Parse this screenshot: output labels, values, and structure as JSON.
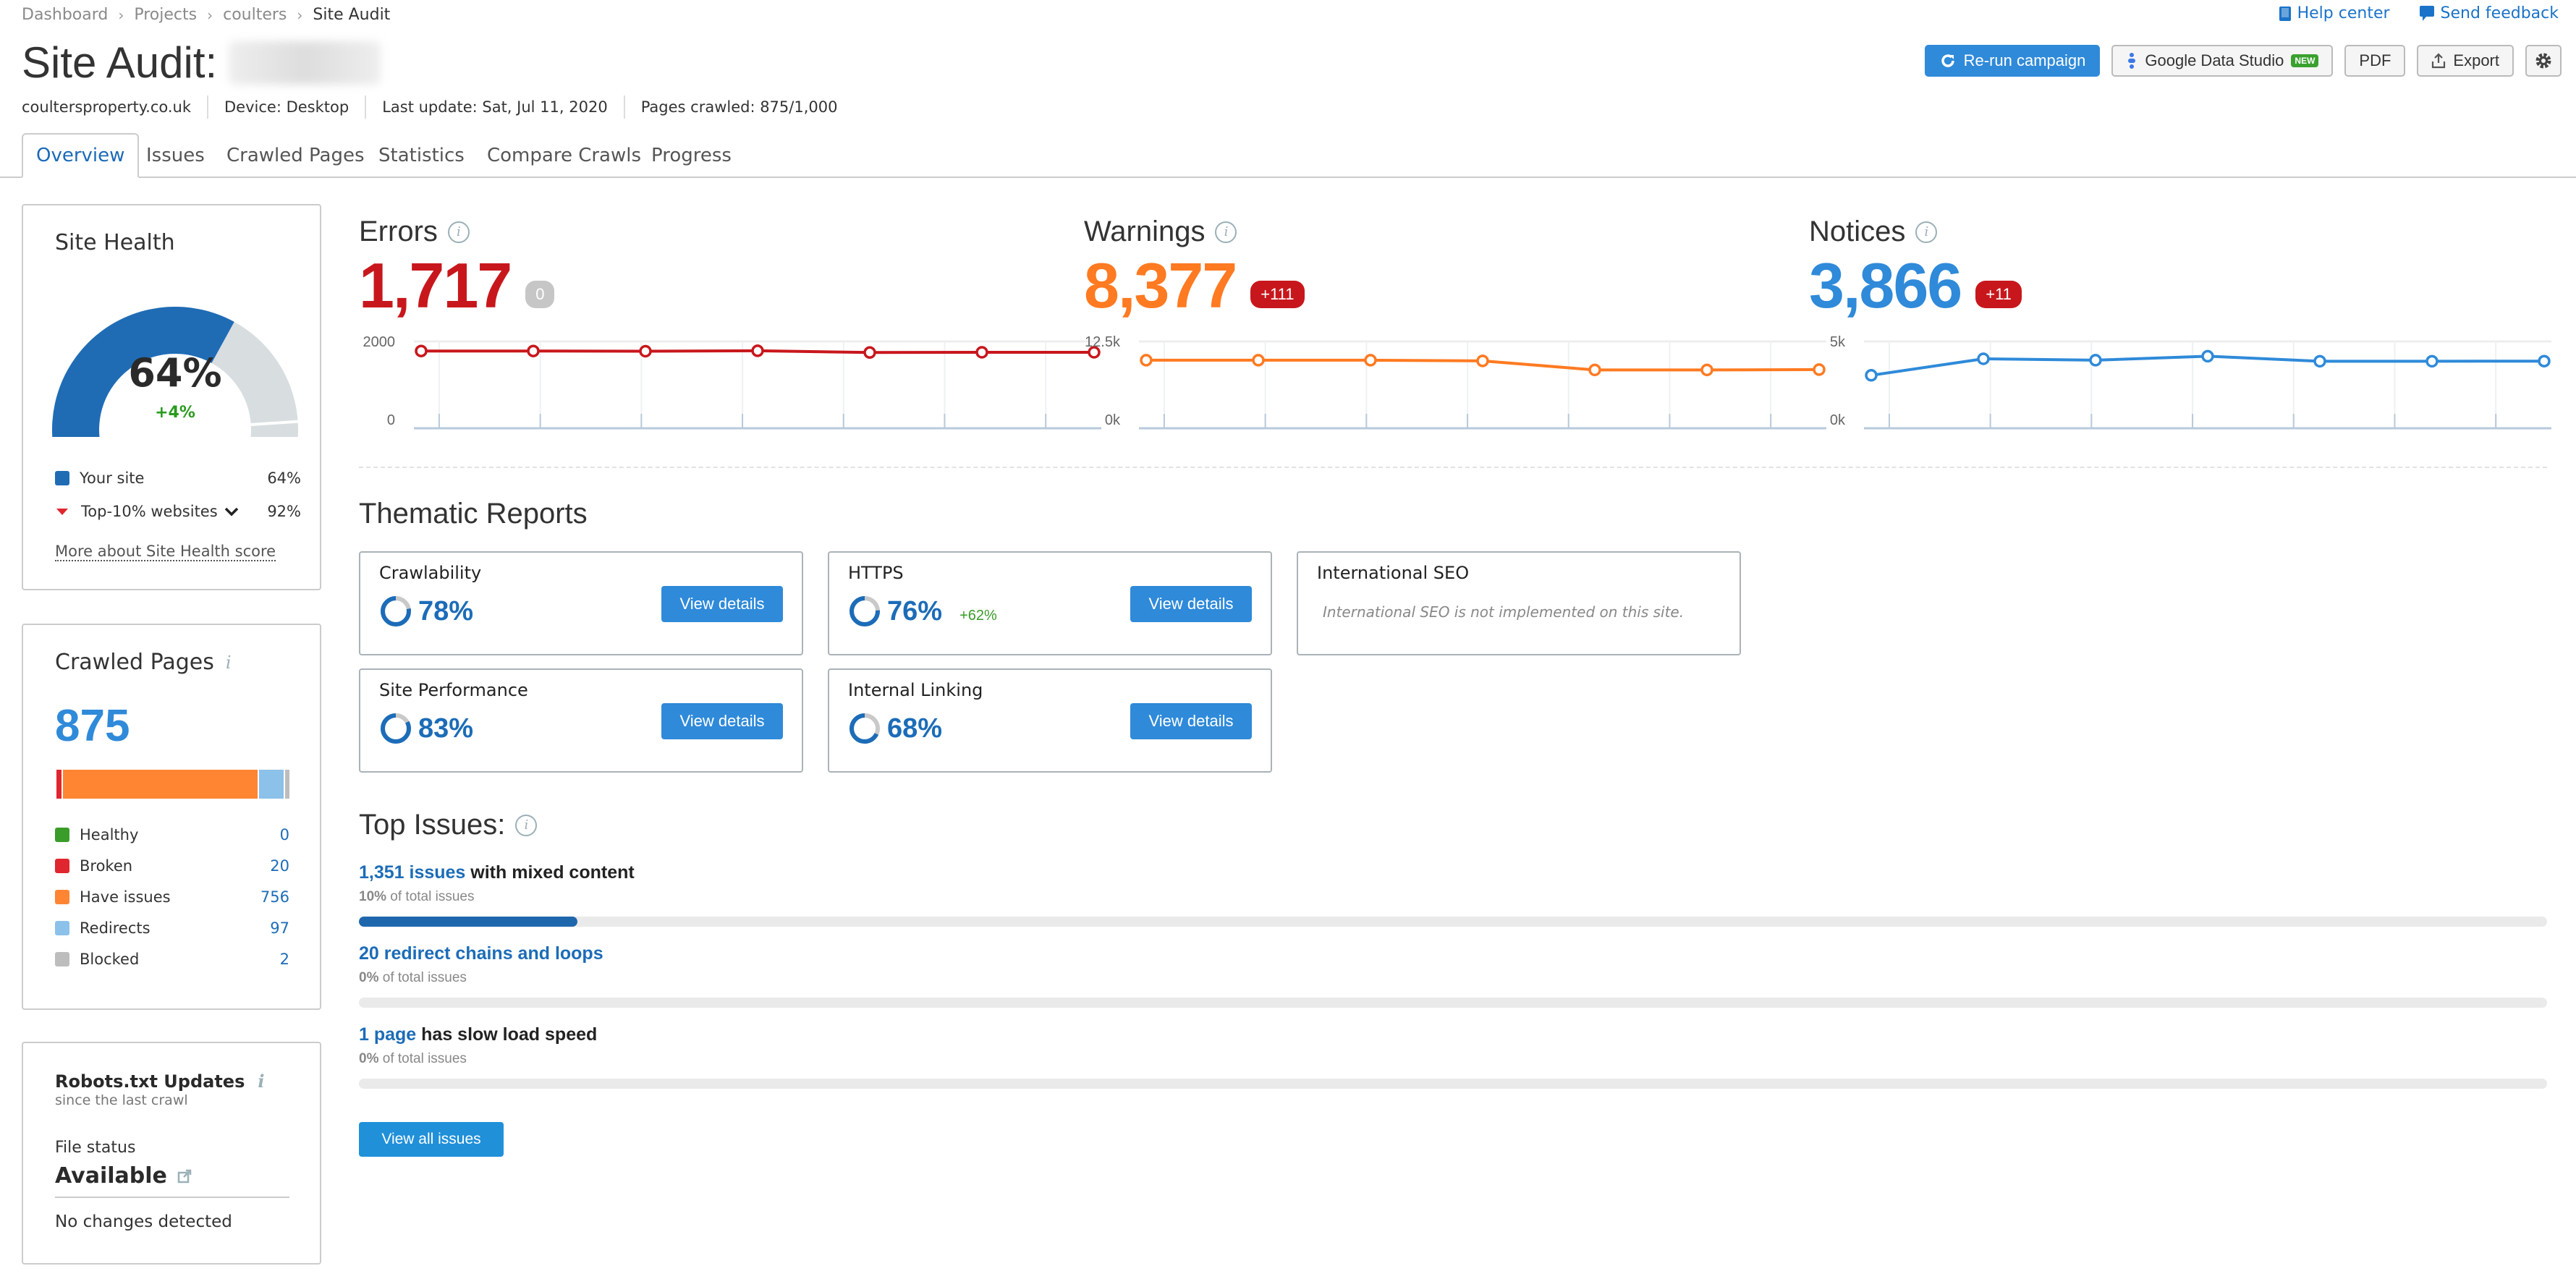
{
  "breadcrumb": [
    "Dashboard",
    "Projects",
    "coulters",
    "Site Audit"
  ],
  "top_links": {
    "help": "Help center",
    "feedback": "Send feedback"
  },
  "header": {
    "title_prefix": "Site Audit:",
    "project_name_blurred": "coulters",
    "domain": "coultersproperty.co.uk",
    "device": "Device: Desktop",
    "last_update": "Last update: Sat, Jul 11, 2020",
    "pages_crawled": "Pages crawled: 875/1,000"
  },
  "actions": {
    "rerun": "Re-run campaign",
    "gds": "Google Data Studio",
    "gds_badge": "NEW",
    "pdf": "PDF",
    "export": "Export"
  },
  "tabs": [
    {
      "label": "Overview",
      "active": true
    },
    {
      "label": "Issues"
    },
    {
      "label": "Crawled Pages"
    },
    {
      "label": "Statistics"
    },
    {
      "label": "Compare Crawls"
    },
    {
      "label": "Progress"
    }
  ],
  "site_health": {
    "title": "Site Health",
    "score": "64%",
    "score_value": 64,
    "change": "+4%",
    "top10_value": 92,
    "legend": [
      {
        "label": "Your site",
        "value": "64%"
      },
      {
        "label": "Top-10% websites",
        "value": "92%"
      }
    ],
    "more_link": "More about Site Health score",
    "colors": {
      "site": "#1f6cb5",
      "rest": "#d8dde0",
      "marker": "#e0262e"
    }
  },
  "crawled_pages": {
    "title": "Crawled Pages",
    "total": "875",
    "items": [
      {
        "label": "Healthy",
        "value": "0",
        "count": 0,
        "color": "#3a9d2a"
      },
      {
        "label": "Broken",
        "value": "20",
        "count": 20,
        "color": "#e0262e"
      },
      {
        "label": "Have issues",
        "value": "756",
        "count": 756,
        "color": "#ff8533"
      },
      {
        "label": "Redirects",
        "value": "97",
        "count": 97,
        "color": "#8cc1ea"
      },
      {
        "label": "Blocked",
        "value": "2",
        "count": 2,
        "color": "#bdbdbd"
      }
    ]
  },
  "robots": {
    "title": "Robots.txt Updates",
    "subtitle": "since the last crawl",
    "file_status_label": "File status",
    "file_status": "Available",
    "changes": "No changes detected"
  },
  "metrics": [
    {
      "title": "Errors",
      "value": "1,717",
      "delta": "0",
      "color": "#c8171c",
      "delta_bg": "#c6c6c6",
      "ymax_label": "2000",
      "ymin_label": "0",
      "ymax": 2000,
      "points": [
        1780,
        1780,
        1775,
        1785,
        1745,
        1750,
        1750
      ]
    },
    {
      "title": "Warnings",
      "value": "8,377",
      "delta": "+111",
      "color": "#ff7a21",
      "delta_bg": "#c8171c",
      "ymax_label": "12.5k",
      "ymin_label": "0k",
      "ymax": 12500,
      "points": [
        9800,
        9800,
        9800,
        9700,
        8400,
        8400,
        8450
      ]
    },
    {
      "title": "Notices",
      "value": "3,866",
      "delta": "+11",
      "color": "#2f8ad9",
      "delta_bg": "#c8171c",
      "ymax_label": "5k",
      "ymin_label": "0k",
      "ymax": 5000,
      "points": [
        3050,
        4000,
        3920,
        4150,
        3860,
        3860,
        3866
      ]
    }
  ],
  "thematic": {
    "title": "Thematic Reports",
    "view_details": "View details",
    "cards": [
      {
        "name": "Crawlability",
        "pct": "78%",
        "value": 78
      },
      {
        "name": "HTTPS",
        "pct": "76%",
        "value": 76,
        "change": "+62%"
      },
      {
        "name": "International SEO",
        "note": "International SEO is not implemented on this site."
      },
      {
        "name": "Site Performance",
        "pct": "83%",
        "value": 83
      },
      {
        "name": "Internal Linking",
        "pct": "68%",
        "value": 68
      }
    ]
  },
  "top_issues": {
    "title": "Top Issues:",
    "items": [
      {
        "link": "1,351 issues",
        "rest": " with mixed content",
        "pct": "10%",
        "pct_suffix": " of total issues",
        "fill": 10
      },
      {
        "link": "20 redirect chains and loops",
        "rest": "",
        "pct": "0%",
        "pct_suffix": " of total issues",
        "fill": 0
      },
      {
        "link": "1 page",
        "rest": " has slow load speed",
        "pct": "0%",
        "pct_suffix": " of total issues",
        "fill": 0
      }
    ],
    "view_all": "View all issues"
  }
}
